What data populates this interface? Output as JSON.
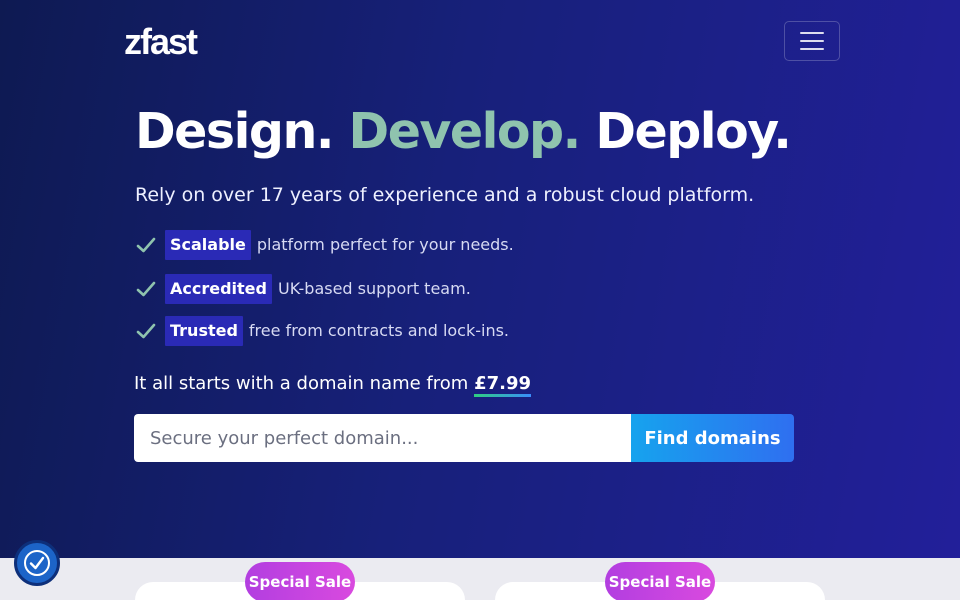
{
  "header": {
    "logo_text": "zfast",
    "menu_icon": "hamburger-menu-icon"
  },
  "hero": {
    "headline": {
      "part1": "Design.",
      "part2": "Develop.",
      "part3": "Deploy."
    },
    "subtitle": "Rely on over 17 years of experience and a robust cloud platform.",
    "features": [
      {
        "tag": "Scalable",
        "desc": "platform perfect for your needs."
      },
      {
        "tag": "Accredited",
        "desc": "UK-based support team."
      },
      {
        "tag": "Trusted",
        "desc": "free from contracts and lock-ins."
      }
    ],
    "price_text": "It all starts with a domain name from",
    "price_value": "£7.99"
  },
  "search": {
    "placeholder": "Secure your perfect domain...",
    "button_label": "Find domains"
  },
  "cards": [
    {
      "badge": "Special Sale"
    },
    {
      "badge": "Special Sale"
    }
  ],
  "colors": {
    "accent_headline": "#8fc3ae",
    "tag_bg": "#2a2ab6",
    "check": "#8fc3ae",
    "button_start": "#16a3ee",
    "button_end": "#2f6ff0",
    "badge": "#c444df"
  }
}
